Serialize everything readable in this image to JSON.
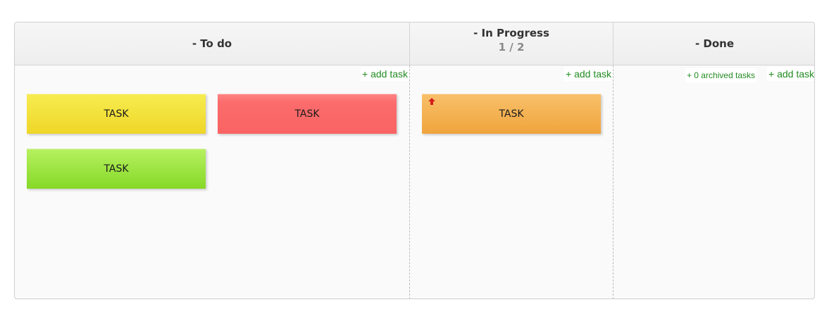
{
  "columns": {
    "todo": {
      "title": "- To do",
      "add_task": "+ add task",
      "cards": [
        {
          "label": "TASK",
          "color": "#f4e035"
        },
        {
          "label": "TASK",
          "color": "#fb6a6a"
        },
        {
          "label": "TASK",
          "color": "#99e23a"
        }
      ]
    },
    "in_progress": {
      "title": "- In Progress",
      "count": "1 / 2",
      "add_task": "+ add task",
      "cards": [
        {
          "label": "TASK",
          "color": "#f4ac4a",
          "priority_icon": "red-up-arrow-icon",
          "priority_color": "#d41e1e"
        }
      ]
    },
    "done": {
      "title": "- Done",
      "archived": "+ 0 archived tasks",
      "add_task": "+ add task"
    }
  },
  "colors": {
    "link": "#228b22",
    "header_bg": "#f2f2f2",
    "board_bg": "#fafafa"
  }
}
